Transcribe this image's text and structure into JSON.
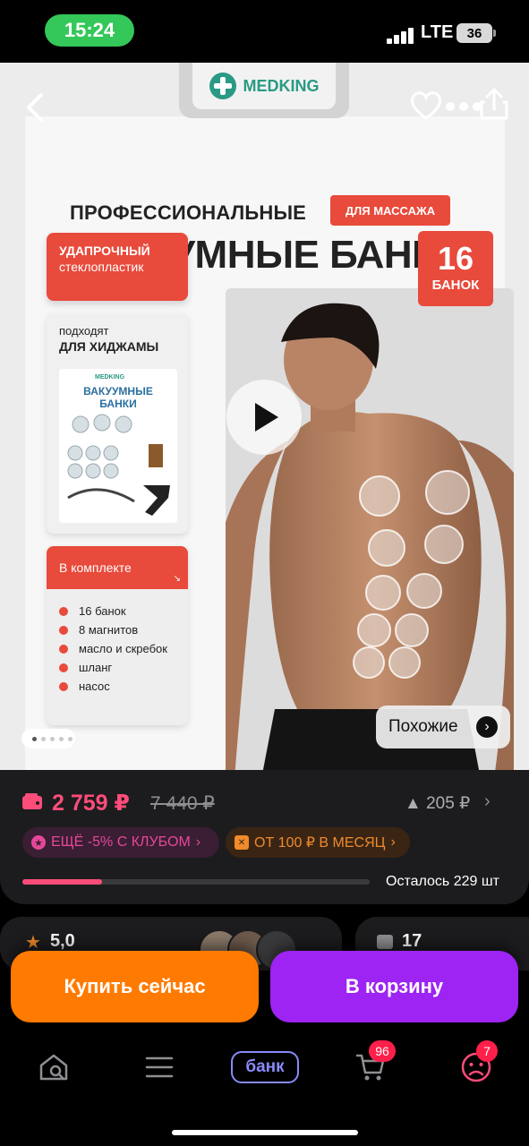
{
  "status_bar": {
    "time": "15:24",
    "network": "LTE",
    "battery": "36"
  },
  "gallery": {
    "brand": "MEDKING",
    "headline_line1": "ПРОФЕССИОНАЛЬНЫЕ",
    "tag": "ДЛЯ МАССАЖА",
    "headline_line2": "ВАКУУМНЫЕ БАНКИ",
    "count_number": "16",
    "count_label": "БАНОК",
    "feature_1_title": "УДАПРОЧНЫЙ",
    "feature_1_sub": "стеклопластик",
    "feature_2_sub": "подходят",
    "feature_2_title": "ДЛЯ ХИДЖАМЫ",
    "box_brand": "MEDKING",
    "box_title": "ВАКУУМНЫЕ БАНКИ",
    "kit_title": "В комплекте",
    "kit_items": [
      "16 банок",
      "8 магнитов",
      "масло и скребок",
      "шланг",
      "насос"
    ],
    "similar_label": "Похожие",
    "icons": {
      "back": "chevron-left-icon",
      "favorite": "heart-icon",
      "more": "more-dots-icon",
      "share": "share-icon",
      "play": "play-icon"
    }
  },
  "price": {
    "current": "2 759 ₽",
    "old": "7 440 ₽",
    "change": "▲ 205 ₽",
    "club_chip": "ЕЩЁ -5% С КЛУБОМ",
    "installment_chip": "ОТ 100 ₽ В МЕСЯЦ",
    "stock_text": "Осталось 229 шт",
    "stock_fraction": 0.23,
    "accent_color": "#ff4d7a"
  },
  "rating": {
    "value": "5,0",
    "questions": "17"
  },
  "actions": {
    "buy_now": "Купить сейчас",
    "add_to_cart": "В корзину",
    "buy_color": "#ff7a00",
    "cart_color": "#9d24f3"
  },
  "nav": {
    "bank_label": "банк",
    "cart_badge": "96",
    "profile_badge": "7",
    "badge_color": "#ff1f4b"
  }
}
